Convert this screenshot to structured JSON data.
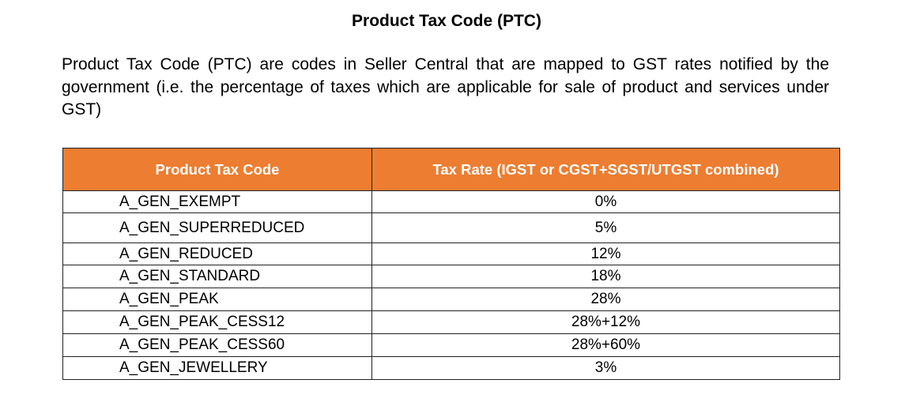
{
  "title": "Product Tax Code (PTC)",
  "description": "Product Tax Code (PTC) are codes in Seller Central that are mapped to GST rates notified by the government (i.e. the percentage of taxes which are applicable for sale of product and services under GST)",
  "table": {
    "header_color": "#ED7D31",
    "headers": [
      "Product Tax Code",
      "Tax Rate (IGST or CGST+SGST/UTGST combined)"
    ],
    "rows": [
      {
        "code": "A_GEN_EXEMPT",
        "rate": "0%"
      },
      {
        "code": "A_GEN_SUPERREDUCED",
        "rate": "5%"
      },
      {
        "code": "A_GEN_REDUCED",
        "rate": "12%"
      },
      {
        "code": "A_GEN_STANDARD",
        "rate": "18%"
      },
      {
        "code": "A_GEN_PEAK",
        "rate": "28%"
      },
      {
        "code": "A_GEN_PEAK_CESS12",
        "rate": "28%+12%"
      },
      {
        "code": "A_GEN_PEAK_CESS60",
        "rate": "28%+60%"
      },
      {
        "code": "A_GEN_JEWELLERY",
        "rate": "3%"
      }
    ]
  }
}
